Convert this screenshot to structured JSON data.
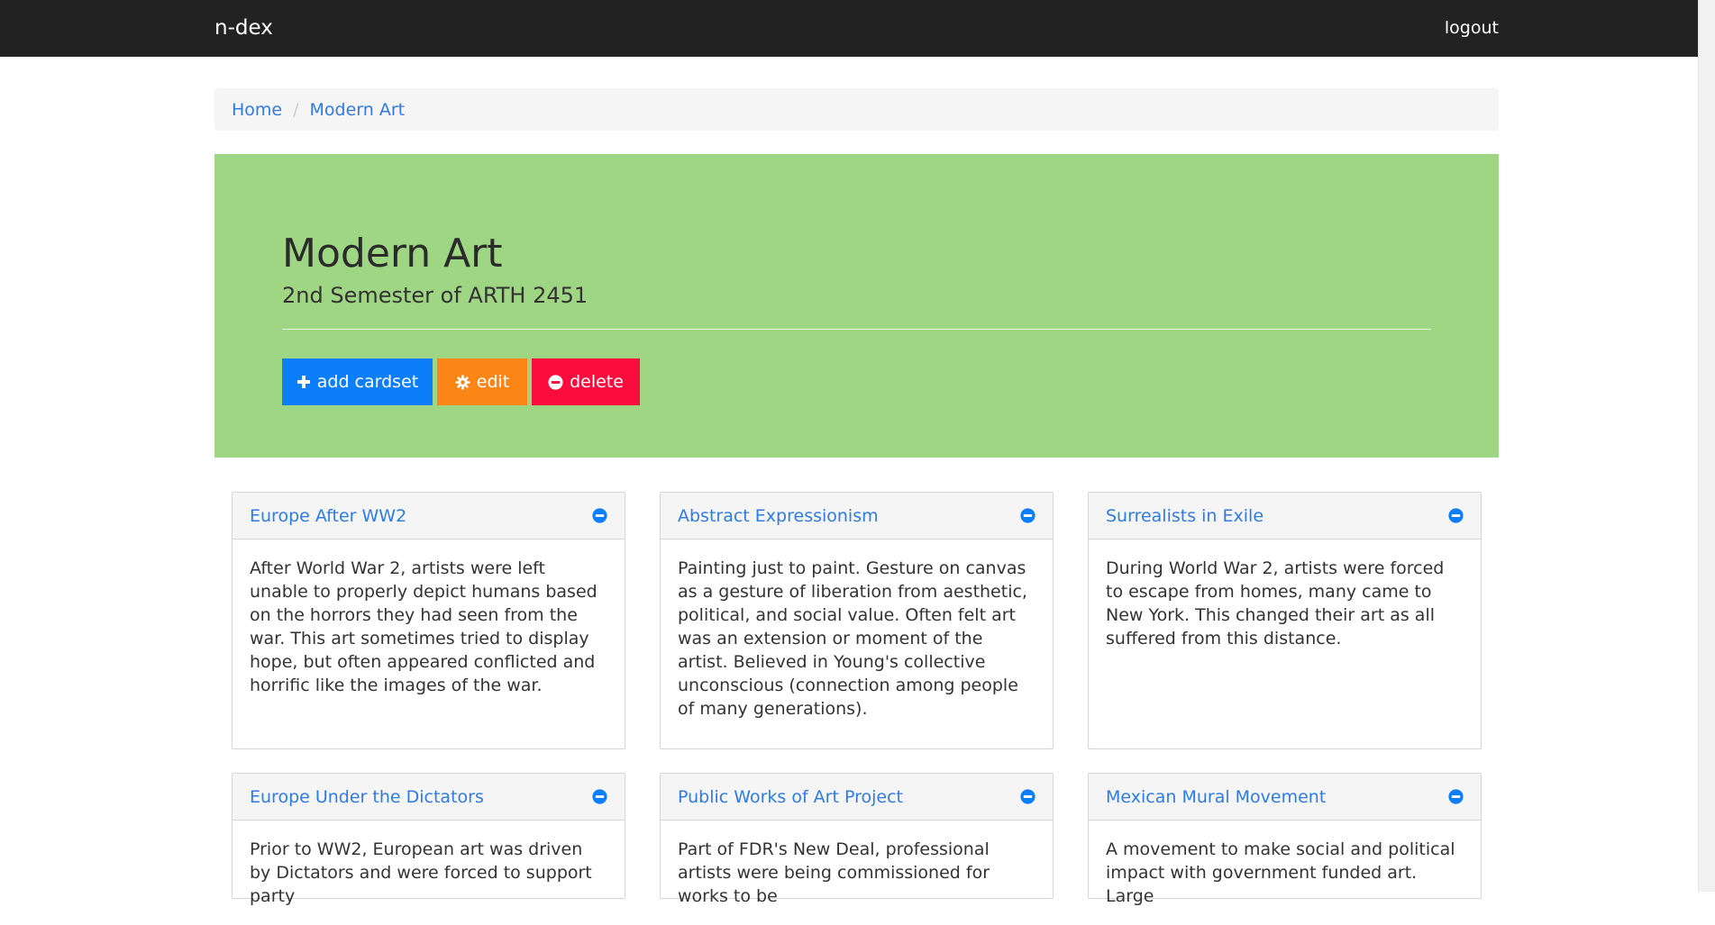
{
  "navbar": {
    "brand": "n-dex",
    "logout": "logout"
  },
  "breadcrumb": {
    "items": [
      "Home",
      "Modern Art"
    ]
  },
  "course": {
    "title": "Modern Art",
    "subtitle": "2nd Semester of ARTH 2451",
    "color": "#9fd683"
  },
  "actions": {
    "add": "add cardset",
    "edit": "edit",
    "delete": "delete"
  },
  "cardsets": [
    {
      "title": "Europe After WW2",
      "text": "After World War 2, artists were left unable to properly depict humans based on the horrors they had seen from the war. This art sometimes tried to display hope, but often appeared conflicted and horrific like the images of the war."
    },
    {
      "title": "Abstract Expressionism",
      "text": "Painting just to paint. Gesture on canvas as a gesture of liberation from aesthetic, political, and social value. Often felt art was an extension or moment of the artist. Believed in Young's collective unconscious (connection among people of many generations)."
    },
    {
      "title": "Surrealists in Exile",
      "text": "During World War 2, artists were forced to escape from homes, many came to New York. This changed their art as all suffered from this distance."
    },
    {
      "title": "Europe Under the Dictators",
      "text": "Prior to WW2, European art was driven by Dictators and were forced to support party"
    },
    {
      "title": "Public Works of Art Project",
      "text": "Part of FDR's New Deal, professional artists were being commissioned for works to be"
    },
    {
      "title": "Mexican Mural Movement",
      "text": "A movement to make social and political impact with government funded art. Large"
    }
  ],
  "colors": {
    "navbar": "#222222",
    "link": "#2f7be0",
    "add_button": "#0d7efa",
    "edit_button": "#fb8615",
    "delete_button": "#fa0c3d"
  },
  "icons": {
    "add": "plus-icon",
    "edit": "gear-icon",
    "delete": "minus-circle-icon",
    "remove_cardset": "minus-circle-icon"
  }
}
